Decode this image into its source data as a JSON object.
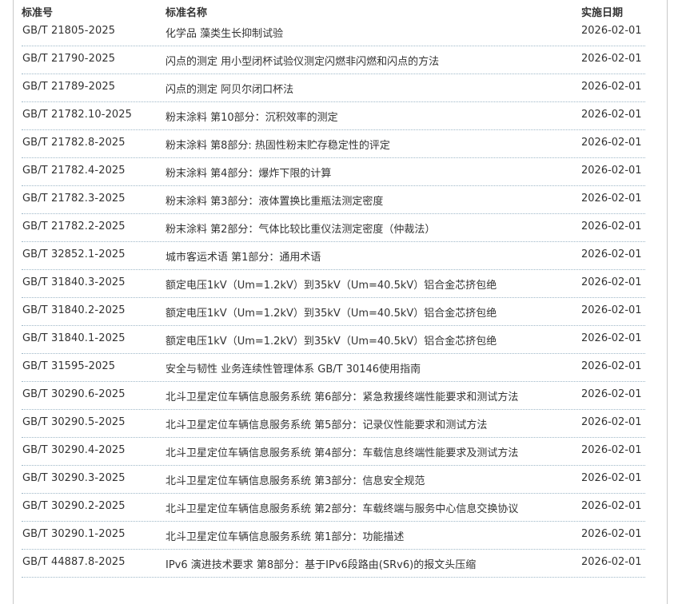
{
  "columns": {
    "code": "标准号",
    "name": "标准名称",
    "date": "实施日期"
  },
  "rows": [
    {
      "code": "GB/T 21805-2025",
      "name": "化学品 藻类生长抑制试验",
      "date": "2026-02-01"
    },
    {
      "code": "GB/T 21790-2025",
      "name": "闪点的测定 用小型闭杯试验仪测定闪燃非闪燃和闪点的方法",
      "date": "2026-02-01"
    },
    {
      "code": "GB/T 21789-2025",
      "name": "闪点的测定 阿贝尔闭口杯法",
      "date": "2026-02-01"
    },
    {
      "code": "GB/T 21782.10-2025",
      "name": "粉末涂料 第10部分：沉积效率的测定",
      "date": "2026-02-01"
    },
    {
      "code": "GB/T 21782.8-2025",
      "name": "粉末涂料 第8部分: 热固性粉末贮存稳定性的评定",
      "date": "2026-02-01"
    },
    {
      "code": "GB/T 21782.4-2025",
      "name": "粉末涂料 第4部分：爆炸下限的计算",
      "date": "2026-02-01"
    },
    {
      "code": "GB/T 21782.3-2025",
      "name": "粉末涂料 第3部分：液体置换比重瓶法测定密度",
      "date": "2026-02-01"
    },
    {
      "code": "GB/T 21782.2-2025",
      "name": "粉末涂料 第2部分：气体比较比重仪法测定密度（仲裁法）",
      "date": "2026-02-01"
    },
    {
      "code": "GB/T 32852.1-2025",
      "name": "城市客运术语 第1部分：通用术语",
      "date": "2026-02-01"
    },
    {
      "code": "GB/T 31840.3-2025",
      "name": "额定电压1kV（Um=1.2kV）到35kV（Um=40.5kV）铝合金芯挤包绝",
      "date": "2026-02-01"
    },
    {
      "code": "GB/T 31840.2-2025",
      "name": "额定电压1kV（Um=1.2kV）到35kV（Um=40.5kV）铝合金芯挤包绝",
      "date": "2026-02-01"
    },
    {
      "code": "GB/T 31840.1-2025",
      "name": "额定电压1kV（Um=1.2kV）到35kV（Um=40.5kV）铝合金芯挤包绝",
      "date": "2026-02-01"
    },
    {
      "code": "GB/T 31595-2025",
      "name": "安全与韧性 业务连续性管理体系 GB/T 30146使用指南",
      "date": "2026-02-01"
    },
    {
      "code": "GB/T 30290.6-2025",
      "name": "北斗卫星定位车辆信息服务系统 第6部分：紧急救援终端性能要求和测试方法",
      "date": "2026-02-01"
    },
    {
      "code": "GB/T 30290.5-2025",
      "name": "北斗卫星定位车辆信息服务系统 第5部分：记录仪性能要求和测试方法",
      "date": "2026-02-01"
    },
    {
      "code": "GB/T 30290.4-2025",
      "name": "北斗卫星定位车辆信息服务系统 第4部分：车载信息终端性能要求及测试方法",
      "date": "2026-02-01"
    },
    {
      "code": "GB/T 30290.3-2025",
      "name": "北斗卫星定位车辆信息服务系统 第3部分：信息安全规范",
      "date": "2026-02-01"
    },
    {
      "code": "GB/T 30290.2-2025",
      "name": "北斗卫星定位车辆信息服务系统 第2部分：车载终端与服务中心信息交换协议",
      "date": "2026-02-01"
    },
    {
      "code": "GB/T 30290.1-2025",
      "name": "北斗卫星定位车辆信息服务系统 第1部分：功能描述",
      "date": "2026-02-01"
    },
    {
      "code": "GB/T 44887.8-2025",
      "name": "IPv6 演进技术要求 第8部分：基于IPv6段路由(SRv6)的报文头压缩",
      "date": "2026-02-01"
    }
  ]
}
